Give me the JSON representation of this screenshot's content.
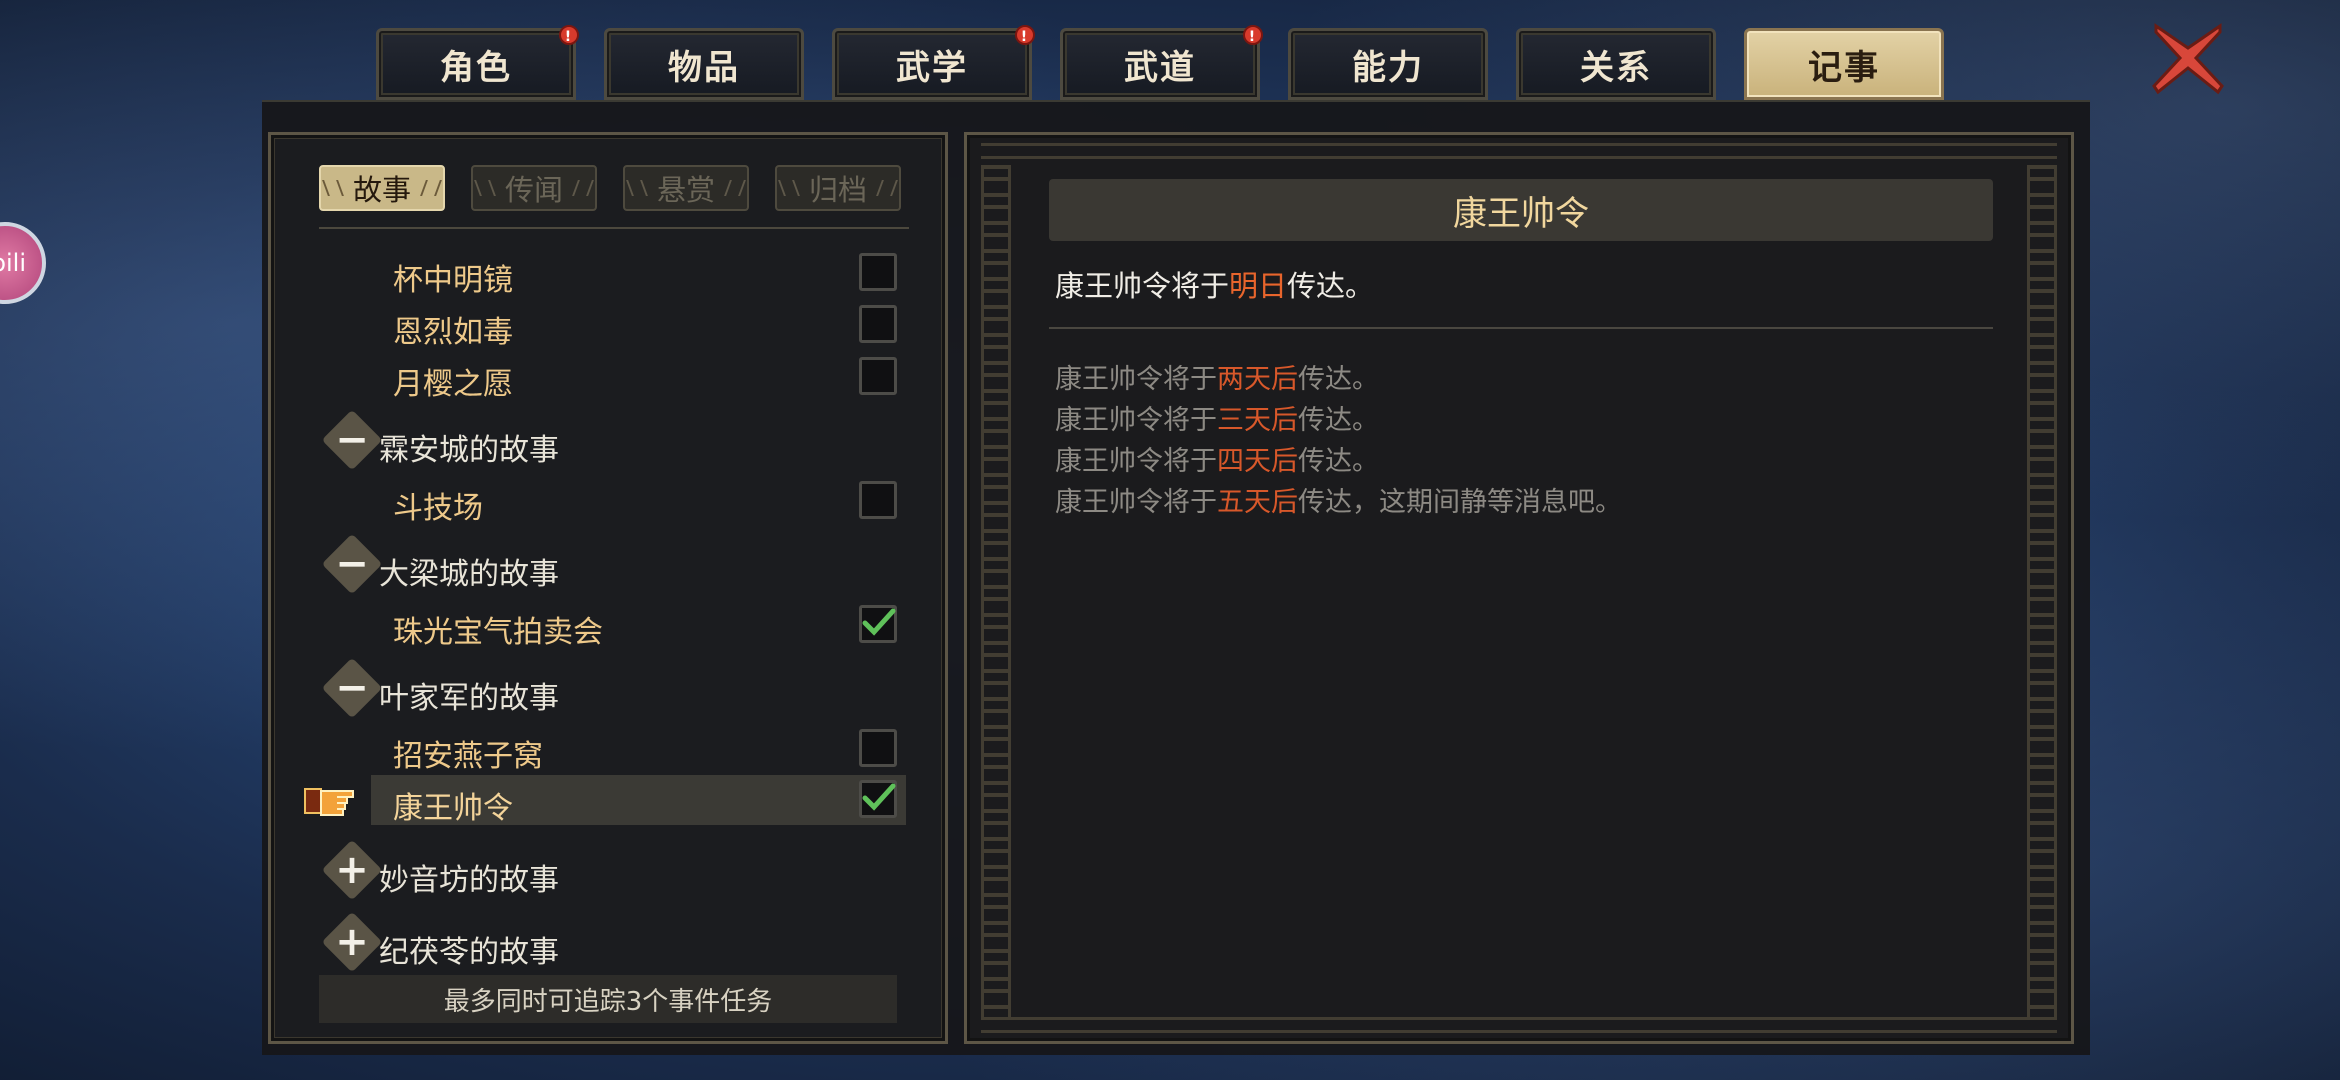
{
  "top_tabs": [
    {
      "label": "角色",
      "badge": "!"
    },
    {
      "label": "物品",
      "badge": ""
    },
    {
      "label": "武学",
      "badge": "!"
    },
    {
      "label": "武道",
      "badge": "!"
    },
    {
      "label": "能力",
      "badge": ""
    },
    {
      "label": "关系",
      "badge": ""
    },
    {
      "label": "记事",
      "badge": "",
      "active": true
    }
  ],
  "floating_avatar": {
    "label": "bili"
  },
  "sub_tabs": [
    {
      "label": "故事",
      "active": true
    },
    {
      "label": "传闻"
    },
    {
      "label": "悬赏"
    },
    {
      "label": "归档"
    }
  ],
  "story_list": {
    "ungrouped": [
      {
        "label": "杯中明镜",
        "tracked": false
      },
      {
        "label": "恩烈如毒",
        "tracked": false
      },
      {
        "label": "月樱之愿",
        "tracked": false
      }
    ],
    "groups": [
      {
        "title": "霖安城的故事",
        "expanded": true,
        "items": [
          {
            "label": "斗技场",
            "tracked": false
          }
        ]
      },
      {
        "title": "大梁城的故事",
        "expanded": true,
        "items": [
          {
            "label": "珠光宝气拍卖会",
            "tracked": true
          }
        ]
      },
      {
        "title": "叶家军的故事",
        "expanded": true,
        "items": [
          {
            "label": "招安燕子窝",
            "tracked": false
          },
          {
            "label": "康王帅令",
            "tracked": true,
            "selected": true
          }
        ]
      },
      {
        "title": "妙音坊的故事",
        "expanded": false,
        "items": []
      },
      {
        "title": "纪茯苓的故事",
        "expanded": false,
        "items": []
      }
    ],
    "footer": "最多同时可追踪3个事件任务"
  },
  "detail": {
    "title": "康王帅令",
    "main": {
      "before": "康王帅令将于",
      "highlight": "明日",
      "after": "传达。"
    },
    "history": [
      {
        "before": "康王帅令将于",
        "highlight": "两天后",
        "after": "传达。"
      },
      {
        "before": "康王帅令将于",
        "highlight": "三天后",
        "after": "传达。"
      },
      {
        "before": "康王帅令将于",
        "highlight": "四天后",
        "after": "传达。"
      },
      {
        "before": "康王帅令将于",
        "highlight": "五天后",
        "after": "传达，这期间静等消息吧。"
      }
    ]
  },
  "symbols": {
    "collapse": "−",
    "expand": "+",
    "check": "✔"
  },
  "colors": {
    "accent_gold": "#eec98a",
    "highlight_orange": "#e8652c",
    "check_green": "#5fc15a",
    "close_red": "#d8473a"
  }
}
